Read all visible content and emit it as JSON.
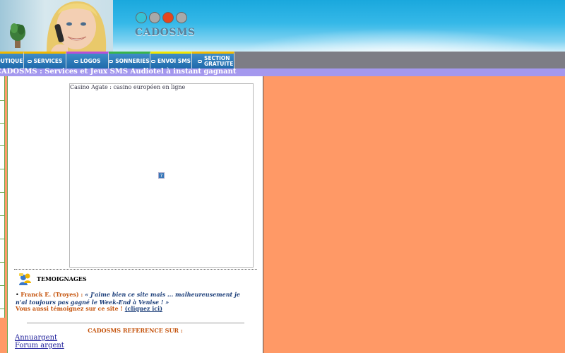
{
  "header": {
    "brand": "CADOSMS",
    "dot_colors": [
      "#35c2d6",
      "#a9a9a9",
      "#e6461e",
      "#a9a9a9"
    ]
  },
  "nav": {
    "items": [
      {
        "label": "BOUTIQUE",
        "accent": "#f2b900"
      },
      {
        "label": "SERVICES",
        "accent": "#f2b900"
      },
      {
        "label": "LOGOS",
        "accent": "#b84fd8"
      },
      {
        "label": "SONNERIES",
        "accent": "#39b54a"
      },
      {
        "label": "ENVOI SMS",
        "accent": "#f2e600"
      },
      {
        "label": "SECTION GRATUITE",
        "accent": "#f2b900"
      }
    ]
  },
  "page_title": "CADOSMS : Services et Jeux SMS Audiotel à instant gagnant",
  "ad": {
    "title": "Casino Agate : casino européen en ligne",
    "placeholder_glyph": "?"
  },
  "testimonials": {
    "title": "TEMOIGNAGES",
    "bullet": "•",
    "author": "Franck E. (Troyes)",
    "separator": " : ",
    "quote": "« J'aime bien ce site mais ... malheureusement je n'ai toujours pas gagné le Week-End à Venise ! »",
    "invite_text": "Vous aussi témoignez sur ce site ! ",
    "invite_link": "(cliquez ici)"
  },
  "references": {
    "title": "CADOSMS REFERENCE SUR :",
    "links": [
      "Annuargent",
      "Forum argent"
    ]
  },
  "colors": {
    "page_bg": "#ff9966",
    "title_strip": "#a498ee",
    "nav_bg": "#1f6aaa",
    "accent_orange": "#c5540d",
    "link_blue": "#1a1a99"
  }
}
